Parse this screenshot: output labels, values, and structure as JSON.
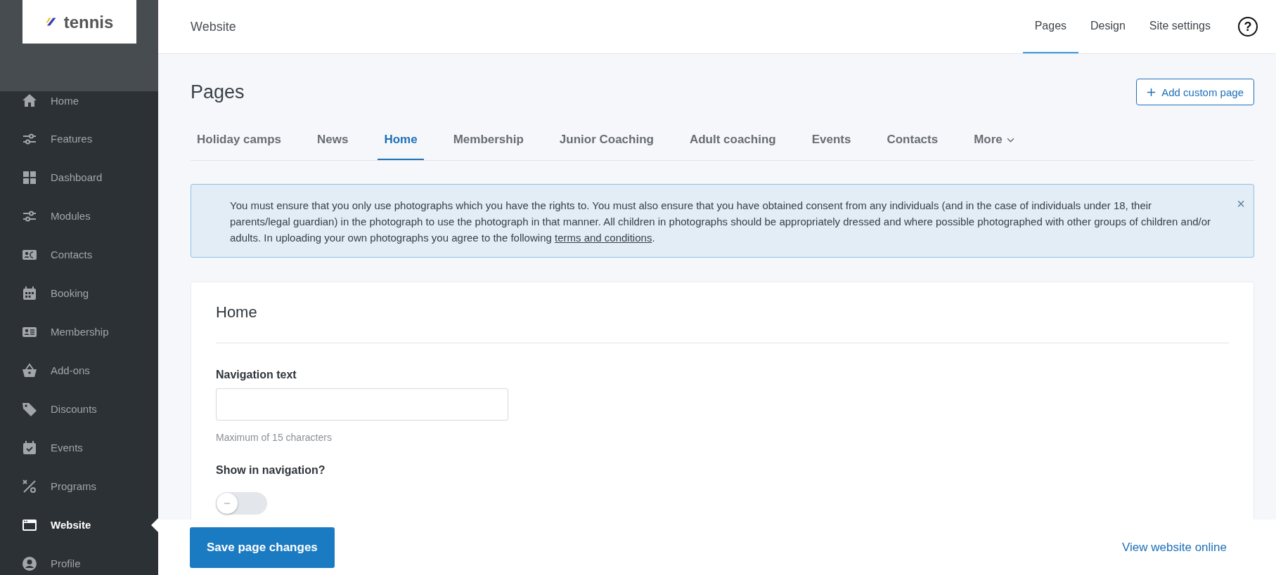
{
  "logo": {
    "text": "tennis"
  },
  "sidebar": {
    "items": [
      {
        "label": "Home",
        "selected": false
      },
      {
        "label": "Features",
        "selected": false
      },
      {
        "label": "Dashboard",
        "selected": false
      },
      {
        "label": "Modules",
        "selected": false
      },
      {
        "label": "Contacts",
        "selected": false
      },
      {
        "label": "Booking",
        "selected": false
      },
      {
        "label": "Membership",
        "selected": false
      },
      {
        "label": "Add-ons",
        "selected": false
      },
      {
        "label": "Discounts",
        "selected": false
      },
      {
        "label": "Events",
        "selected": false
      },
      {
        "label": "Programs",
        "selected": false
      },
      {
        "label": "Website",
        "selected": true
      },
      {
        "label": "Profile",
        "selected": false
      }
    ]
  },
  "header": {
    "title": "Website",
    "nav": [
      {
        "label": "Pages",
        "selected": true
      },
      {
        "label": "Design",
        "selected": false
      },
      {
        "label": "Site settings",
        "selected": false
      }
    ],
    "help": "?"
  },
  "page_title": "Pages",
  "add_button": "Add custom page",
  "page_tabs": [
    {
      "label": "Holiday camps",
      "selected": false
    },
    {
      "label": "News",
      "selected": false
    },
    {
      "label": "Home",
      "selected": true
    },
    {
      "label": "Membership",
      "selected": false
    },
    {
      "label": "Junior Coaching",
      "selected": false
    },
    {
      "label": "Adult coaching",
      "selected": false
    },
    {
      "label": "Events",
      "selected": false
    },
    {
      "label": "Contacts",
      "selected": false
    },
    {
      "label": "More",
      "selected": false,
      "kind": "dropdown"
    }
  ],
  "alert": {
    "text_before": "You must ensure that you only use photographs which you have the rights to. You must also ensure that you have obtained consent from any individuals (and in the case of individuals under 18, their parents/legal guardian) in the photograph to use the photograph in that manner. All children in photographs should be appropriately dressed and where possible photographed with other groups of children and/or adults. In uploading your own photographs you agree to the following ",
    "link": "terms and conditions",
    "text_after": ".",
    "close": "×"
  },
  "card": {
    "title": "Home",
    "navigation_text": {
      "label": "Navigation text",
      "help": "Maximum of 15 characters"
    },
    "show_in_navigation": {
      "label": "Show in navigation?",
      "on": false
    }
  },
  "footer": {
    "save_button": "Save page changes",
    "view_link": "View website online"
  }
}
